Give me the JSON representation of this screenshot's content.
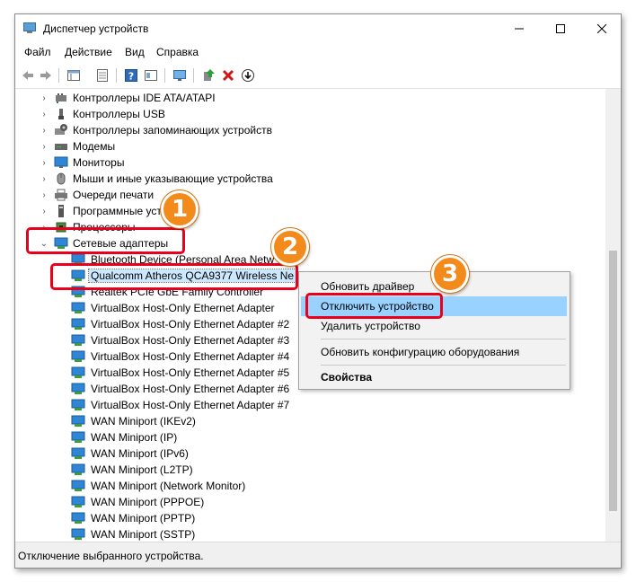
{
  "window": {
    "title": "Диспетчер устройств"
  },
  "menu": [
    "Файл",
    "Действие",
    "Вид",
    "Справка"
  ],
  "tree": {
    "categories": [
      {
        "label": "Контроллеры IDE ATA/ATAPI",
        "icon": "ide-controller-icon"
      },
      {
        "label": "Контроллеры USB",
        "icon": "usb-icon"
      },
      {
        "label": "Контроллеры запоминающих устройств",
        "icon": "storage-controller-icon"
      },
      {
        "label": "Модемы",
        "icon": "modem-icon"
      },
      {
        "label": "Мониторы",
        "icon": "monitor-icon"
      },
      {
        "label": "Мыши и иные указывающие устройства",
        "icon": "mouse-icon"
      },
      {
        "label": "Очереди печати",
        "icon": "printer-icon"
      },
      {
        "label": "Программные устр",
        "icon": "software-device-icon"
      },
      {
        "label": "Процессоры",
        "icon": "cpu-icon"
      }
    ],
    "expanded_category": "Сетевые адаптеры",
    "adapters": [
      "Bluetooth Device (Personal Area Netw",
      "Qualcomm Atheros QCA9377 Wireless Ne",
      "Realtek PCIe GbE Family Controller",
      "VirtualBox Host-Only Ethernet Adapter",
      "VirtualBox Host-Only Ethernet Adapter #2",
      "VirtualBox Host-Only Ethernet Adapter #3",
      "VirtualBox Host-Only Ethernet Adapter #4",
      "VirtualBox Host-Only Ethernet Adapter #5",
      "VirtualBox Host-Only Ethernet Adapter #6",
      "VirtualBox Host-Only Ethernet Adapter #7",
      "WAN Miniport (IKEv2)",
      "WAN Miniport (IP)",
      "WAN Miniport (IPv6)",
      "WAN Miniport (L2TP)",
      "WAN Miniport (Network Monitor)",
      "WAN Miniport (PPPOE)",
      "WAN Miniport (PPTP)",
      "WAN Miniport (SSTP)"
    ]
  },
  "context_menu": {
    "update_driver": "Обновить драйвер",
    "disable_device": "Отключить устройство",
    "uninstall_device": "Удалить устройство",
    "scan_hardware": "Обновить конфигурацию оборудования",
    "properties": "Свойства"
  },
  "status": "Отключение выбранного устройства.",
  "annotations": {
    "step1": "1",
    "step2": "2",
    "step3": "3"
  },
  "colors": {
    "highlight_box": "#e8001c",
    "badge": "#f38b1c",
    "menu_hover": "#99d1ff",
    "selection": "#cce8ff"
  }
}
